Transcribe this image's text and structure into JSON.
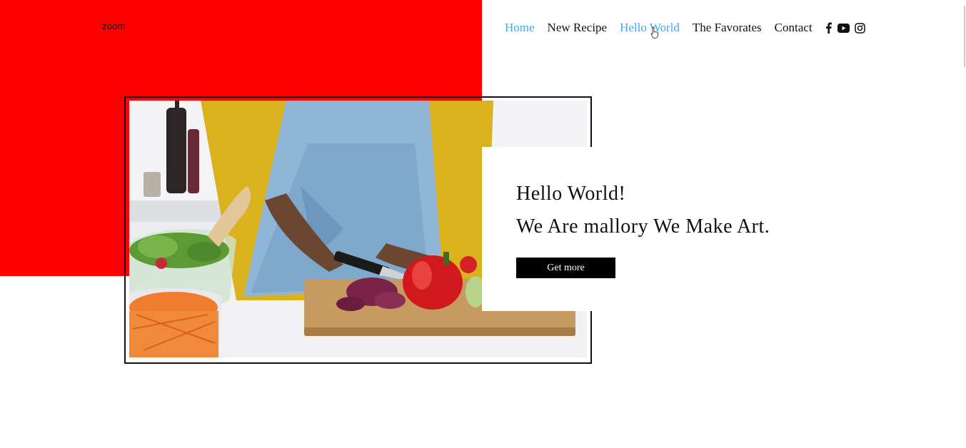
{
  "logo": {
    "text": "zoom"
  },
  "nav": {
    "items": [
      {
        "label": "Home",
        "state": "active"
      },
      {
        "label": "New Recipe"
      },
      {
        "label": "Hello World",
        "state": "hover"
      },
      {
        "label": "The Favorates"
      },
      {
        "label": "Contact"
      }
    ],
    "social_icons": [
      "facebook-icon",
      "youtube-icon",
      "instagram-icon"
    ]
  },
  "hero": {
    "image_icon": "photo-cooking-vegetables",
    "title": "Hello World!",
    "subtitle": "We Are mallory We Make Art.",
    "button_label": "Get more"
  },
  "colors": {
    "accent_red": "#ff0000",
    "link_active": "#3fa9f5",
    "button_bg": "#000000",
    "text": "#111111"
  }
}
